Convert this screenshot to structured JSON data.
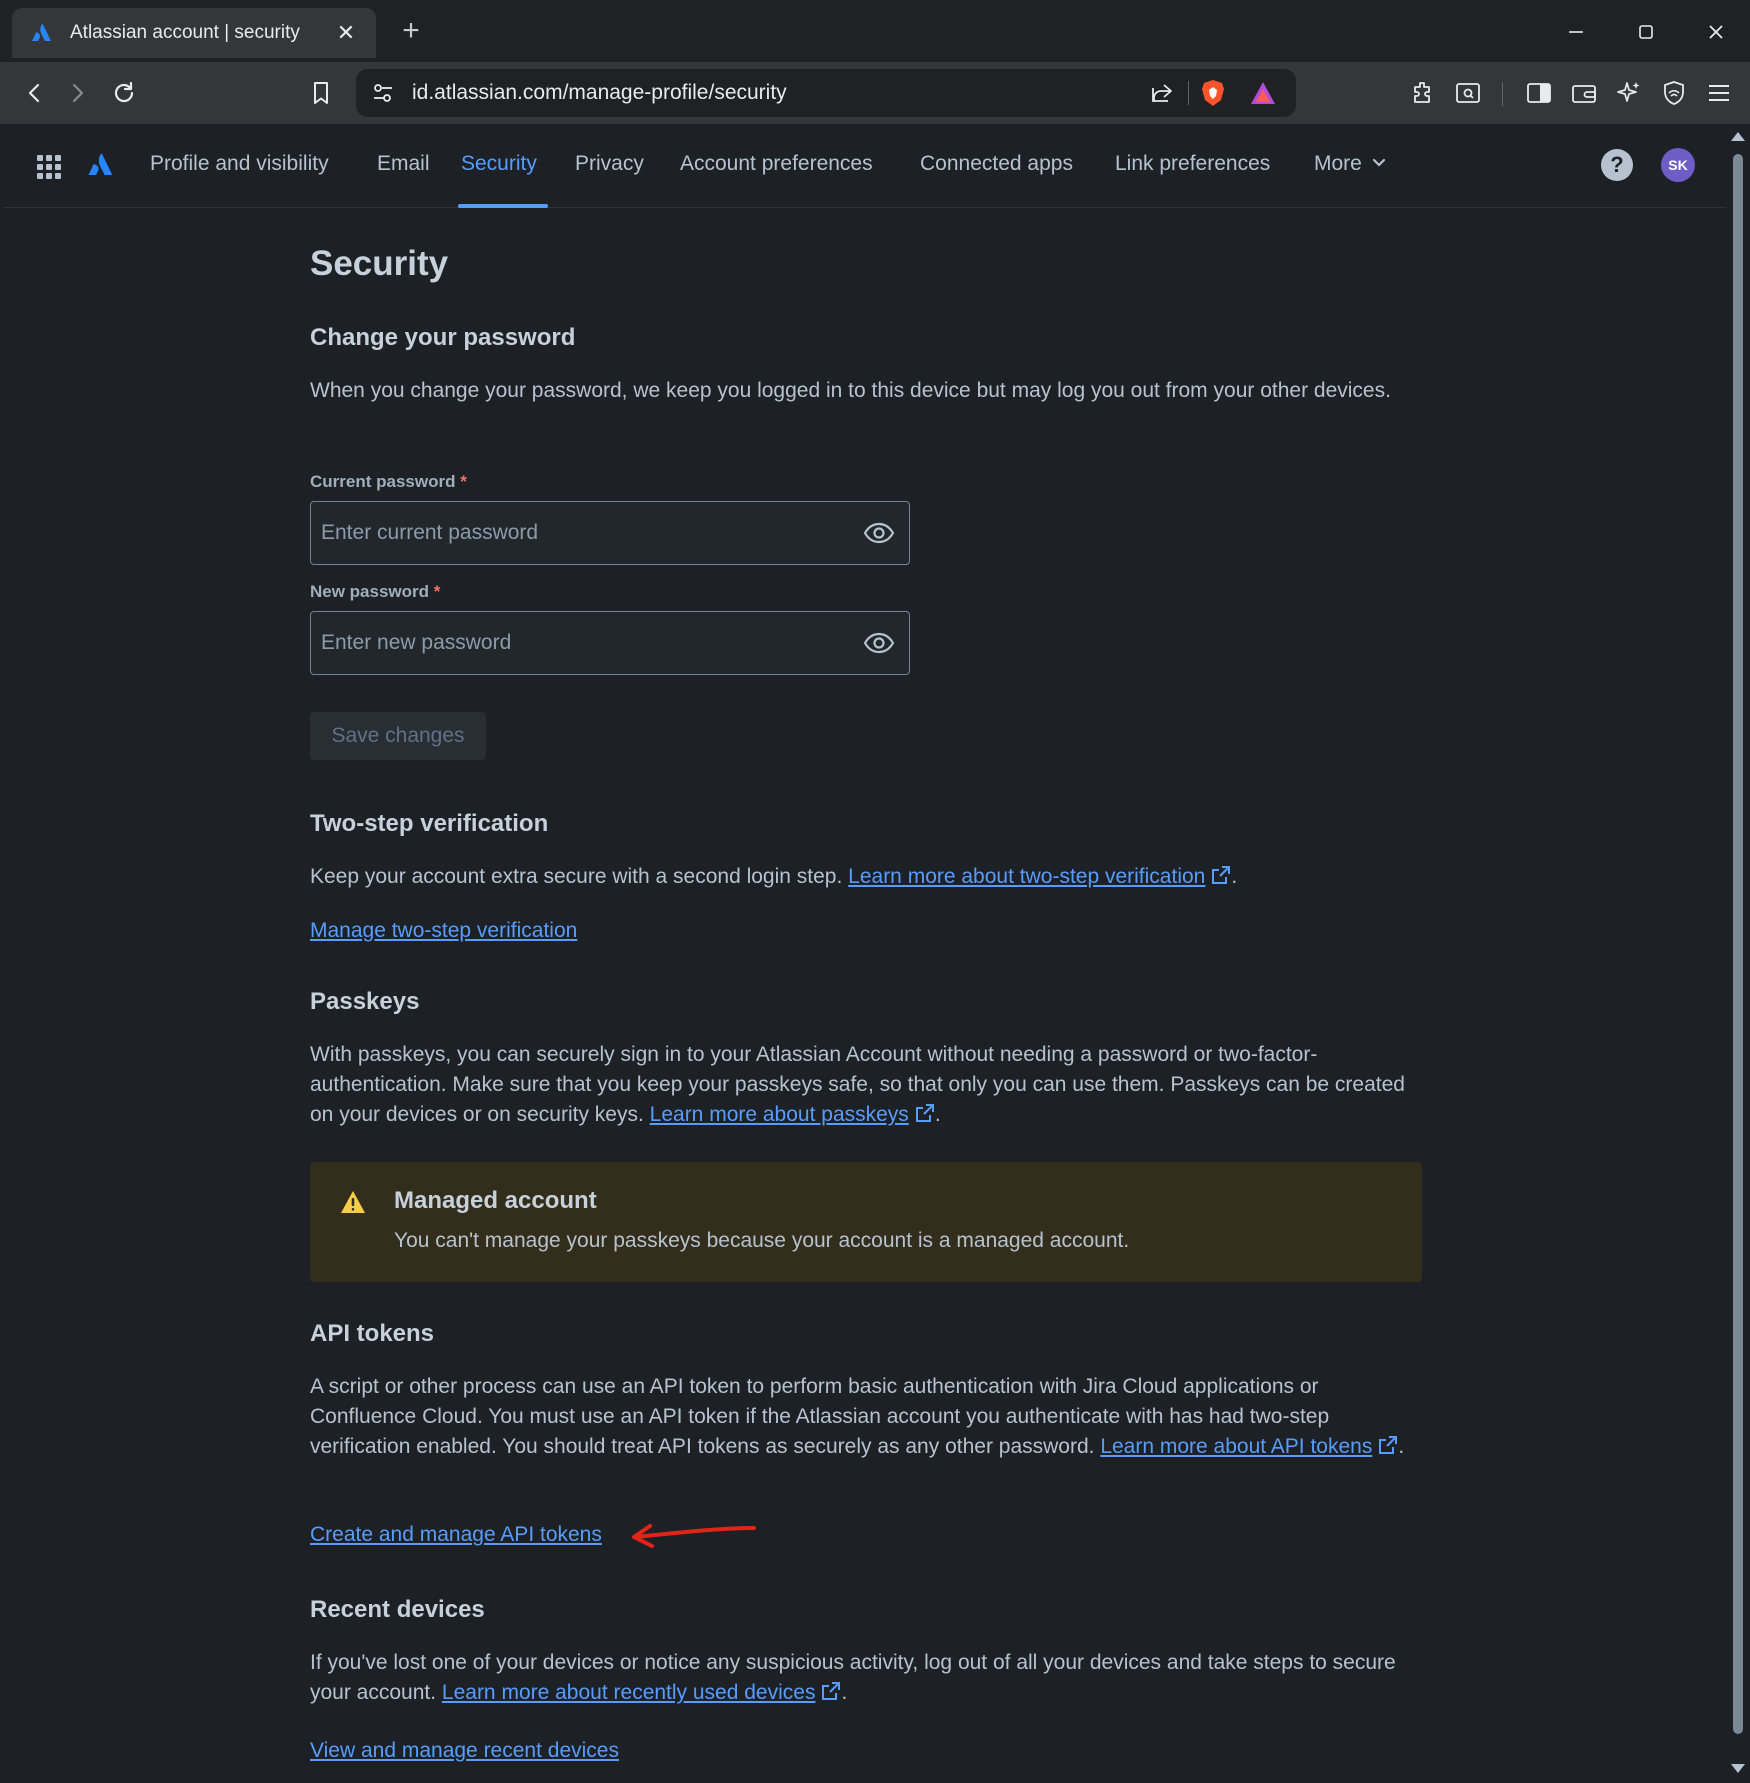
{
  "browser": {
    "tab_title": "Atlassian account | security",
    "url": "id.atlassian.com/manage-profile/security"
  },
  "nav": {
    "items": [
      {
        "label": "Profile and visibility"
      },
      {
        "label": "Email"
      },
      {
        "label": "Security"
      },
      {
        "label": "Privacy"
      },
      {
        "label": "Account preferences"
      },
      {
        "label": "Connected apps"
      },
      {
        "label": "Link preferences"
      },
      {
        "label": "More"
      }
    ],
    "help": "?",
    "avatar": "SK"
  },
  "page": {
    "title": "Security",
    "password": {
      "heading": "Change your password",
      "description": "When you change your password, we keep you logged in to this device but may log you out from your other devices.",
      "current_label": "Current password",
      "current_placeholder": "Enter current password",
      "new_label": "New password",
      "new_placeholder": "Enter new password",
      "required_mark": "*",
      "save_label": "Save changes"
    },
    "two_step": {
      "heading": "Two-step verification",
      "text": "Keep your account extra secure with a second login step. ",
      "learn_link": "Learn more about two-step verification",
      "manage_link": "Manage two-step verification"
    },
    "passkeys": {
      "heading": "Passkeys",
      "text": "With passkeys, you can securely sign in to your Atlassian Account without needing a password or two-factor-authentication. Make sure that you keep your passkeys safe, so that only you can use them. Passkeys can be created on your devices or on security keys. ",
      "learn_link": "Learn more about passkeys",
      "callout_title": "Managed account",
      "callout_text": "You can't manage your passkeys because your account is a managed account."
    },
    "api_tokens": {
      "heading": "API tokens",
      "text": "A script or other process can use an API token to perform basic authentication with Jira Cloud applications or Confluence Cloud. You must use an API token if the Atlassian account you authenticate with has had two-step verification enabled. You should treat API tokens as securely as any other password. ",
      "learn_link": "Learn more about API tokens",
      "manage_link": "Create and manage API tokens"
    },
    "recent_devices": {
      "heading": "Recent devices",
      "text": "If you've lost one of your devices or notice any suspicious activity, log out of all your devices and take steps to secure your account. ",
      "learn_link": "Learn more about recently used devices",
      "manage_link": "View and manage recent devices"
    },
    "period": "."
  },
  "colors": {
    "accent": "#579dff",
    "background": "#1d2125",
    "warning_bg": "#332e1b",
    "annotation": "#e2231a"
  }
}
